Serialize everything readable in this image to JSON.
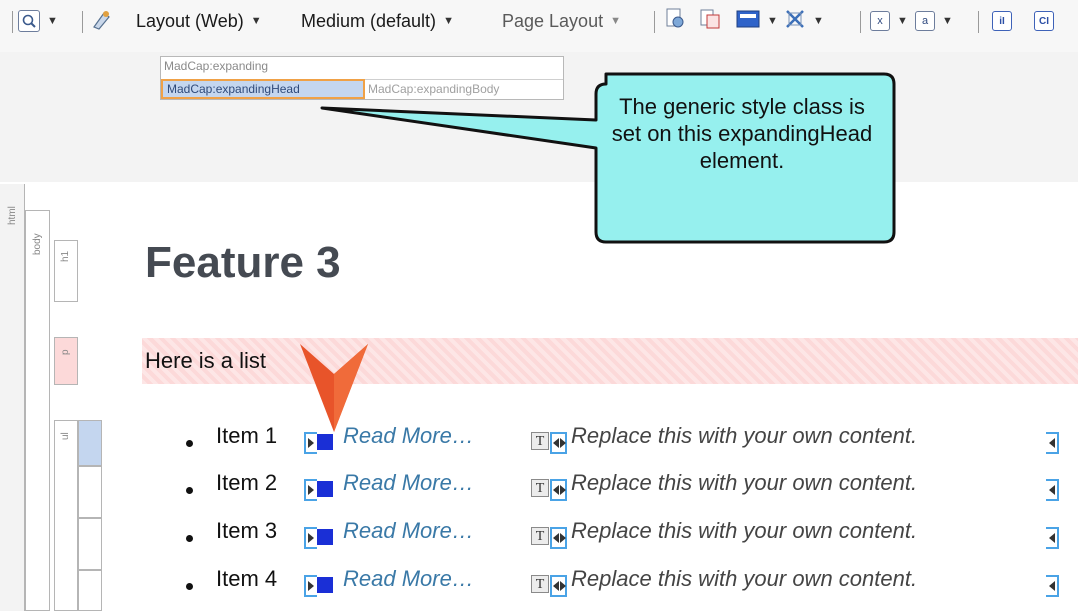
{
  "toolbar": {
    "layout_label": "Layout (Web)",
    "medium_label": "Medium (default)",
    "page_layout_label": "Page Layout",
    "iI_label": "iI",
    "CI_label": "CI",
    "x_label": "x",
    "a_label": "a"
  },
  "structure_bar": {
    "row1": "MadCap:expanding",
    "head": "MadCap:expandingHead",
    "body": "MadCap:expandingBody"
  },
  "callout": {
    "text": "The generic style class is set on this expandingHead element."
  },
  "tags": {
    "html": "html",
    "body": "body",
    "h1": "h1",
    "p": "p",
    "ul": "ul"
  },
  "content": {
    "heading": "Feature 3",
    "paragraph": "Here is a list",
    "t_marker": "T",
    "items": [
      {
        "label": "Item 1",
        "link": "Read More…",
        "body": "Replace this with your own content."
      },
      {
        "label": "Item 2",
        "link": "Read More…",
        "body": "Replace this with your own content."
      },
      {
        "label": "Item 3",
        "link": "Read More…",
        "body": "Replace this with your own content."
      },
      {
        "label": "Item 4",
        "link": "Read More…",
        "body": "Replace this with your own content."
      }
    ]
  },
  "colors": {
    "callout_fill": "#96f0ee",
    "pointer_arrow": "#e8542a",
    "paragraph_bg": "#fcd9d9",
    "link": "#3a79a7",
    "marker_blue": "#1a2fd6"
  }
}
